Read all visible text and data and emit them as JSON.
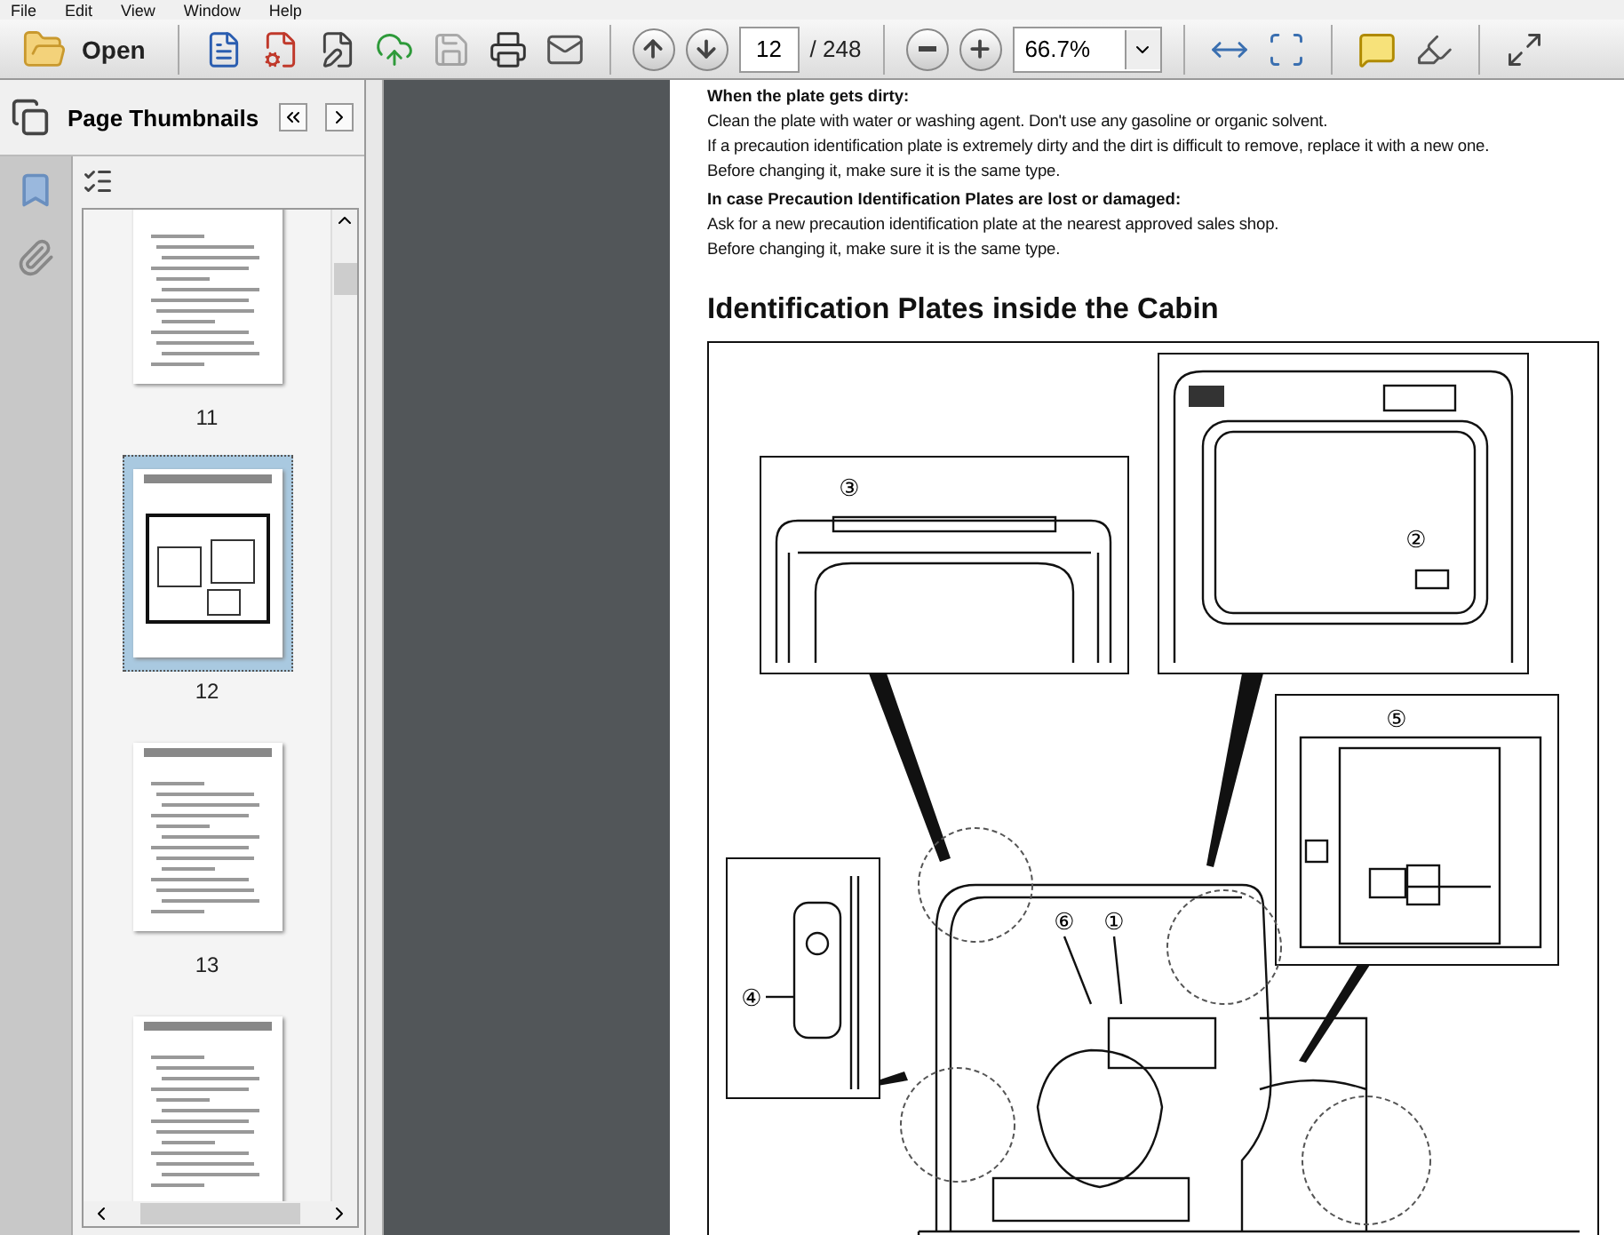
{
  "menu": [
    "File",
    "Edit",
    "View",
    "Window",
    "Help"
  ],
  "toolbar": {
    "open_label": "Open",
    "page_number": "12",
    "page_count": "/ 248",
    "zoom": "66.7%",
    "save_disabled": true
  },
  "panel": {
    "title": "Page Thumbnails",
    "thumbnails": [
      {
        "label": "11",
        "selected": false
      },
      {
        "label": "12",
        "selected": true
      },
      {
        "label": "13",
        "selected": false
      },
      {
        "selected": false
      }
    ]
  },
  "document": {
    "blocks": [
      {
        "heading": "When the plate gets dirty:",
        "lines": [
          "Clean the plate with water or washing agent. Don't use any gasoline or organic solvent.",
          "If a precaution identification plate is extremely dirty and the dirt is difficult to remove, replace it with a new one.",
          "Before changing it, make sure it is the same type."
        ]
      },
      {
        "heading": "In case Precaution Identification Plates are lost or damaged:",
        "lines": [
          "Ask for a new precaution identification plate at the nearest approved sales shop.",
          "Before changing it, make sure it is the same type."
        ]
      }
    ],
    "section_title": "Identification Plates inside the Cabin",
    "callouts": [
      "①",
      "②",
      "③",
      "④",
      "⑤",
      "⑥"
    ]
  }
}
